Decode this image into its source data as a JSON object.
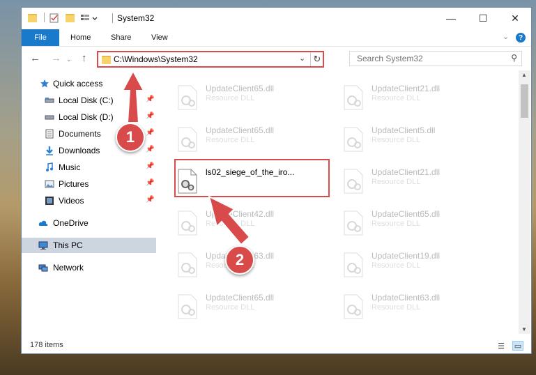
{
  "window": {
    "title": "System32"
  },
  "window_controls": {
    "minimize": "—",
    "maximize": "☐",
    "close": "✕"
  },
  "ribbon": {
    "tabs": [
      {
        "label": "File"
      },
      {
        "label": "Home"
      },
      {
        "label": "Share"
      },
      {
        "label": "View"
      }
    ],
    "help": "?"
  },
  "nav": {
    "back": "←",
    "forward": "→",
    "up": "↑",
    "address": "C:\\Windows\\System32",
    "search_placeholder": "Search System32"
  },
  "sidebar": {
    "items": [
      {
        "label": "Quick access",
        "icon": "star-icon"
      },
      {
        "label": "Local Disk (C:)",
        "icon": "drive-icon"
      },
      {
        "label": "Local Disk (D:)",
        "icon": "drive-icon"
      },
      {
        "label": "Documents",
        "icon": "documents-icon"
      },
      {
        "label": "Downloads",
        "icon": "download-icon"
      },
      {
        "label": "Music",
        "icon": "music-icon"
      },
      {
        "label": "Pictures",
        "icon": "pictures-icon"
      },
      {
        "label": "Videos",
        "icon": "videos-icon"
      },
      {
        "label": "OneDrive",
        "icon": "cloud-icon"
      },
      {
        "label": "This PC",
        "icon": "computer-icon"
      },
      {
        "label": "Network",
        "icon": "network-icon"
      }
    ]
  },
  "files": {
    "col1": [
      {
        "name": "UpdateClient65.dll",
        "type": "Resource DLL"
      },
      {
        "name": "UpdateClient65.dll",
        "type": "Resource DLL"
      },
      {
        "name": "ls02_siege_of_the_iro...",
        "type": ""
      },
      {
        "name": "UpdateClient42.dll",
        "type": "Resource DLL"
      },
      {
        "name": "UpdateClient63.dll",
        "type": "Resource DLL"
      },
      {
        "name": "UpdateClient65.dll",
        "type": "Resource DLL"
      }
    ],
    "col2": [
      {
        "name": "UpdateClient21.dll",
        "type": "Resource DLL"
      },
      {
        "name": "UpdateClient5.dll",
        "type": "Resource DLL"
      },
      {
        "name": "UpdateClient21.dll",
        "type": "Resource DLL"
      },
      {
        "name": "UpdateClient65.dll",
        "type": "Resource DLL"
      },
      {
        "name": "UpdateClient19.dll",
        "type": "Resource DLL"
      },
      {
        "name": "UpdateClient63.dll",
        "type": "Resource DLL"
      }
    ]
  },
  "status": {
    "count": "178 items"
  },
  "callouts": {
    "one": "1",
    "two": "2"
  },
  "colors": {
    "accent": "#1979ca",
    "highlight": "#d94a4a"
  }
}
